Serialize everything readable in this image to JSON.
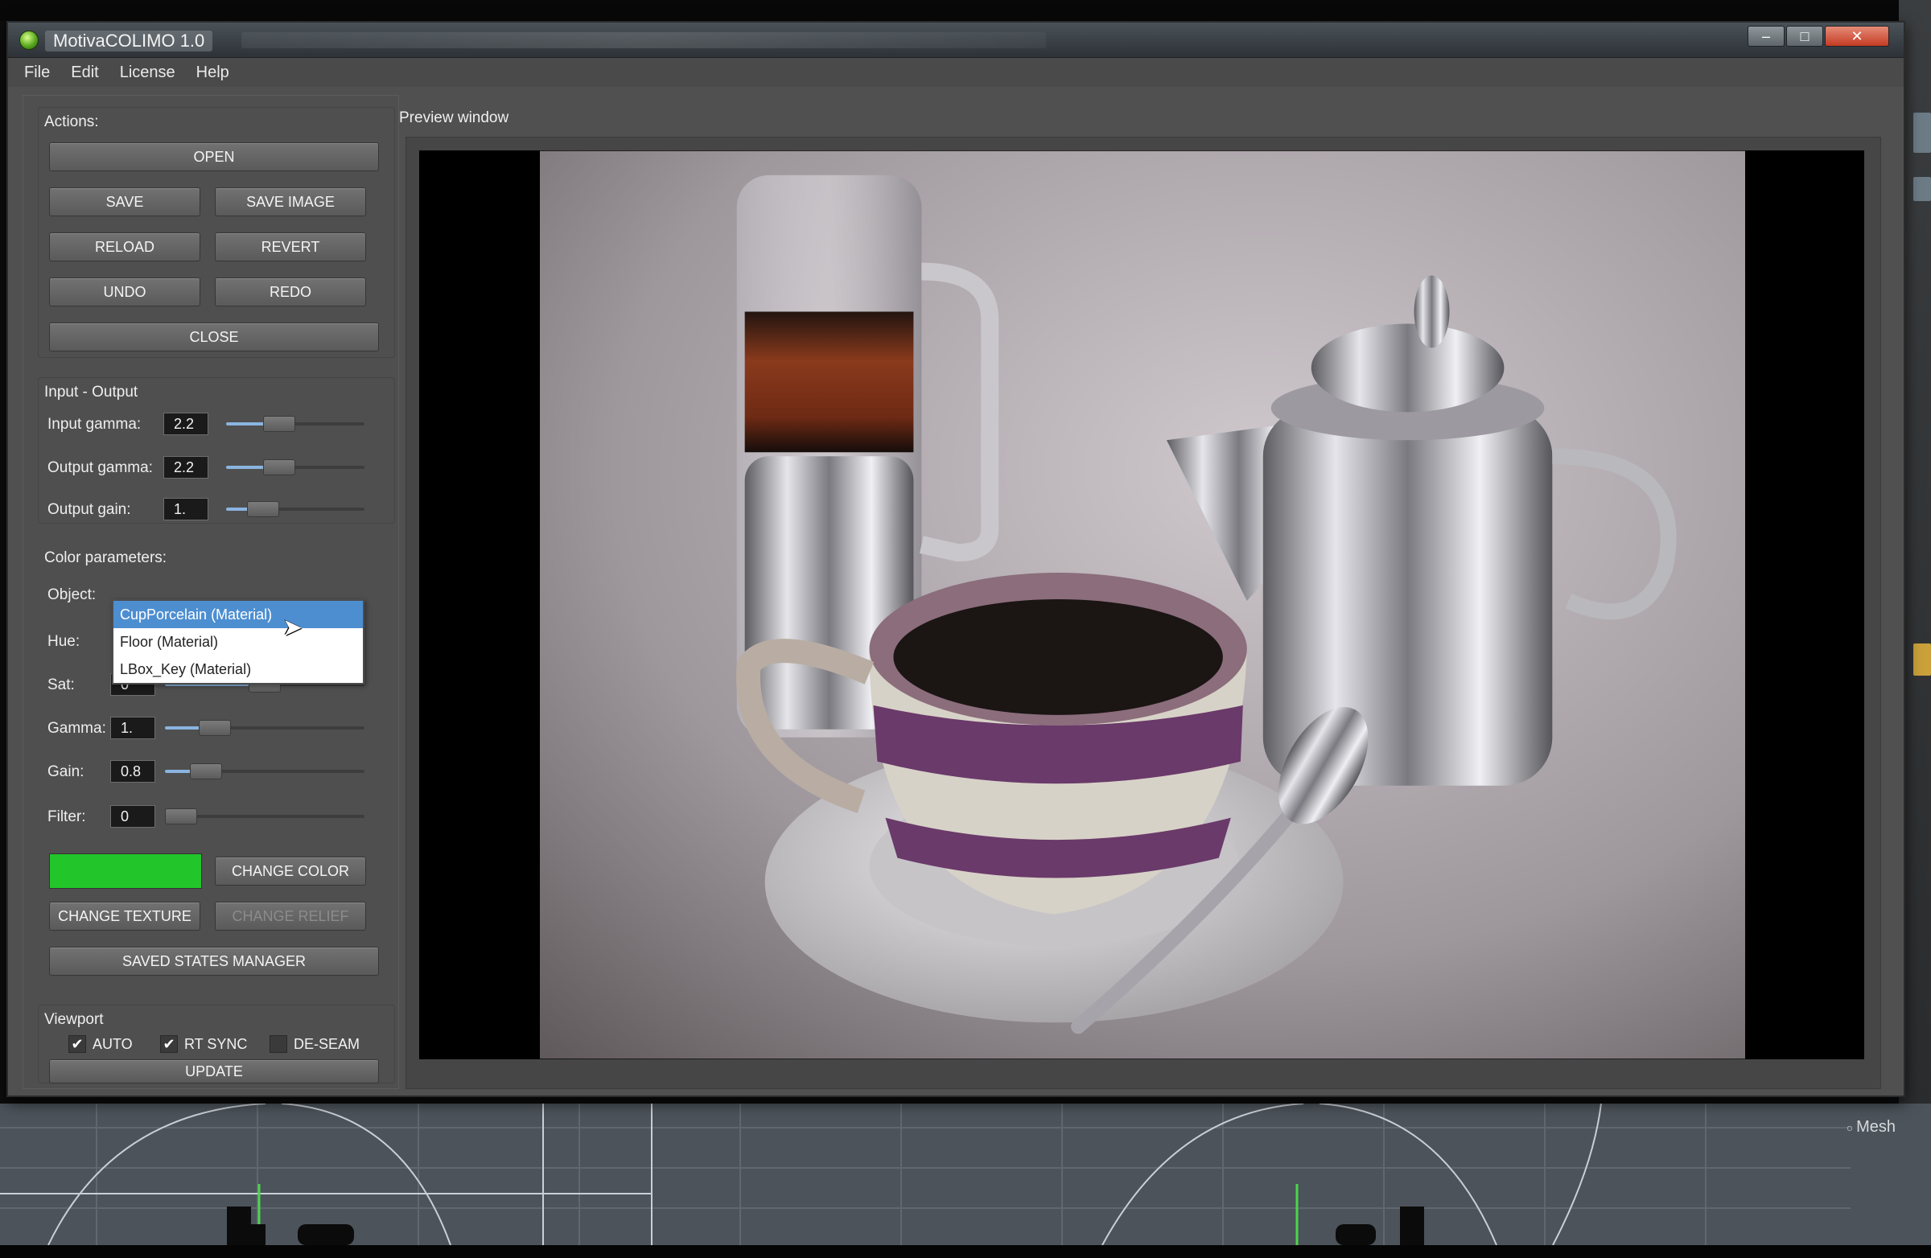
{
  "window": {
    "title": "MotivaCOLIMO 1.0",
    "controls": {
      "minimize": "–",
      "maximize": "□",
      "close": "✕"
    }
  },
  "menu": [
    "File",
    "Edit",
    "License",
    "Help"
  ],
  "actions": {
    "title": "Actions:",
    "buttons": {
      "open": "OPEN",
      "save": "SAVE",
      "save_image": "SAVE IMAGE",
      "reload": "RELOAD",
      "revert": "REVERT",
      "undo": "UNDO",
      "redo": "REDO",
      "close": "CLOSE"
    }
  },
  "input_output": {
    "title": "Input - Output",
    "input_gamma": {
      "label": "Input gamma:",
      "value": "2.2",
      "level": 0.35
    },
    "output_gamma": {
      "label": "Output gamma:",
      "value": "2.2",
      "level": 0.35
    },
    "output_gain": {
      "label": "Output gain:",
      "value": "1.",
      "level": 0.2
    }
  },
  "color_parameters": {
    "title": "Color parameters:",
    "object_label": "Object:",
    "object_options": [
      "CupPorcelain (Material)",
      "Floor (Material)",
      "LBox_Key (Material)"
    ],
    "selected_index": 0,
    "hue_label": "Hue:",
    "sat": {
      "label": "Sat:",
      "value": "0",
      "level": 0.5
    },
    "gamma": {
      "label": "Gamma:",
      "value": "1.",
      "level": 0.2
    },
    "gain": {
      "label": "Gain:",
      "value": "0.8",
      "level": 0.15
    },
    "filter": {
      "label": "Filter:",
      "value": "0",
      "level": 0.0
    },
    "swatch_color": "#22c52a",
    "buttons": {
      "change_color": "CHANGE COLOR",
      "change_texture": "CHANGE TEXTURE",
      "change_relief": "CHANGE RELIEF",
      "saved_states_manager": "SAVED STATES MANAGER"
    }
  },
  "viewport": {
    "title": "Viewport",
    "auto": {
      "label": "AUTO",
      "checked": true
    },
    "rt_sync": {
      "label": "RT SYNC",
      "checked": true
    },
    "de_seam": {
      "label": "DE-SEAM",
      "checked": false
    },
    "update_button": "UPDATE"
  },
  "preview": {
    "title": "Preview window"
  },
  "host_viewport": {
    "mesh_label": "Mesh"
  }
}
